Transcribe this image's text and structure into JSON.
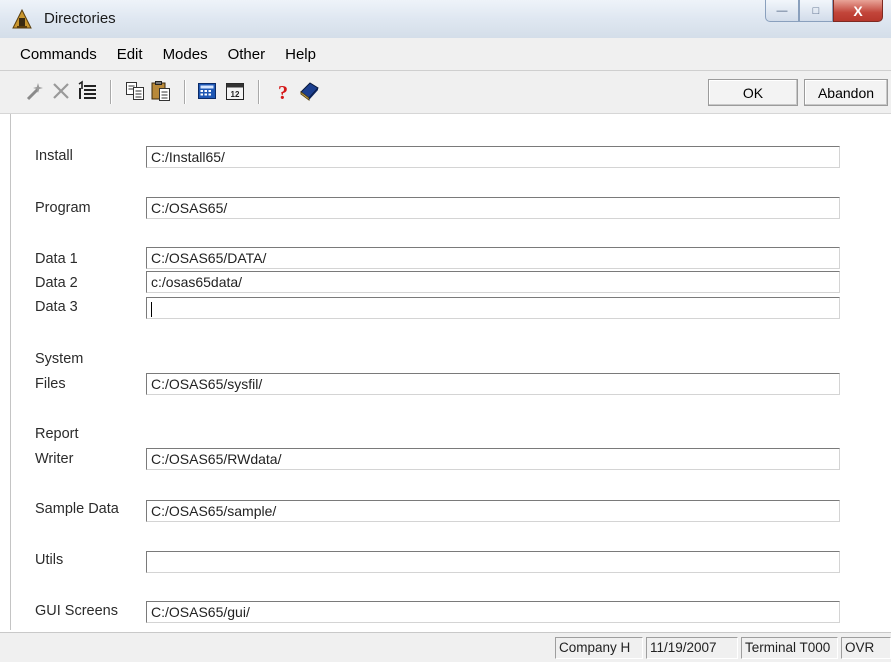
{
  "window": {
    "title": "Directories",
    "minimize_symbol": "—",
    "maximize_symbol": "□",
    "close_symbol": "X"
  },
  "menu": [
    "Commands",
    "Edit",
    "Modes",
    "Other",
    "Help"
  ],
  "toolbar": {
    "icons": [
      "wand-icon",
      "delete-icon",
      "list-icon",
      "copy-icon",
      "paste-icon",
      "calculator-icon",
      "calendar-icon",
      "help-icon",
      "book-icon"
    ],
    "ok_label": "OK",
    "abandon_label": "Abandon"
  },
  "form": {
    "install": {
      "label": "Install",
      "value": "C:/Install65/"
    },
    "program": {
      "label": "Program",
      "value": "C:/OSAS65/"
    },
    "data1": {
      "label": "Data 1",
      "value": "C:/OSAS65/DATA/"
    },
    "data2": {
      "label": "Data 2",
      "value": "c:/osas65data/"
    },
    "data3": {
      "label": "Data 3",
      "value": ""
    },
    "system_files": {
      "label_line1": "System",
      "label_line2": "Files",
      "value": "C:/OSAS65/sysfil/"
    },
    "report_writer": {
      "label_line1": "Report",
      "label_line2": "Writer",
      "value": "C:/OSAS65/RWdata/"
    },
    "sample_data": {
      "label": "Sample Data",
      "value": "C:/OSAS65/sample/"
    },
    "utils": {
      "label": "Utils",
      "value": ""
    },
    "gui_screens": {
      "label": "GUI Screens",
      "value": "C:/OSAS65/gui/"
    }
  },
  "status": {
    "company": "Company H",
    "date": "11/19/2007",
    "terminal": "Terminal T000",
    "mode": "OVR"
  }
}
